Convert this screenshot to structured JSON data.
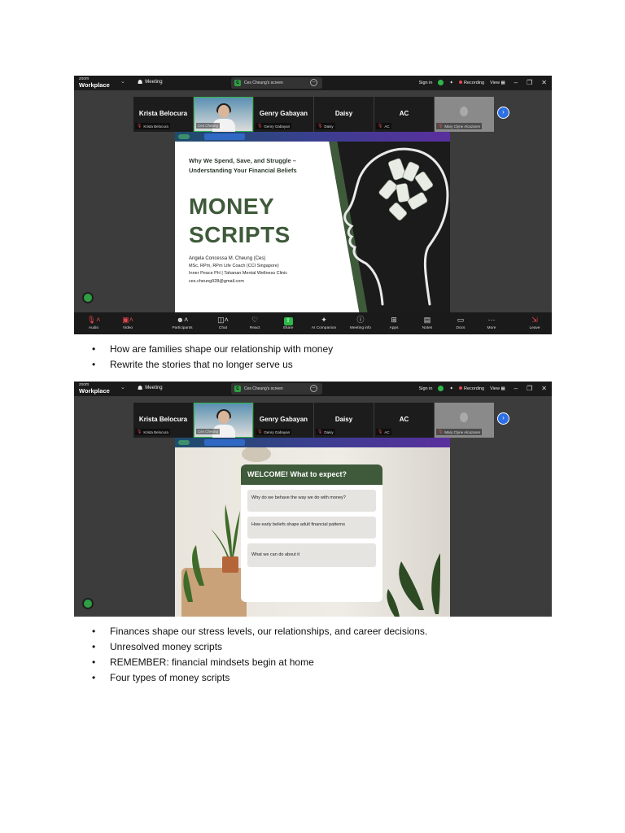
{
  "zoom": {
    "brand_small": "zoom",
    "brand_big": "Workplace",
    "meeting_label": "Meeting",
    "screen_pill_letter": "C",
    "screen_pill_text": "Ces Cheung's screen",
    "sign_in": "Sign in",
    "recording": "Recording",
    "view": "View",
    "participants": [
      {
        "big": "Krista Belocura",
        "small": "Krista Belocura"
      },
      {
        "big": "",
        "small": "Ces Cheung"
      },
      {
        "big": "Genry Gabayan",
        "small": "Genry Gabayan"
      },
      {
        "big": "Daisy",
        "small": "Daisy"
      },
      {
        "big": "AC",
        "small": "AC"
      },
      {
        "big": "",
        "small": "Mary Clyne Alcazaren"
      }
    ],
    "toolbar": [
      {
        "label": "Audio",
        "icon": "mic-icon"
      },
      {
        "label": "Video",
        "icon": "video-off-icon"
      },
      {
        "label": "Participants",
        "icon": "participants-icon",
        "count": "20"
      },
      {
        "label": "Chat",
        "icon": "chat-icon"
      },
      {
        "label": "React",
        "icon": "heart-icon"
      },
      {
        "label": "Share",
        "icon": "share-icon"
      },
      {
        "label": "AI Companion",
        "icon": "sparkle-icon"
      },
      {
        "label": "Meeting info",
        "icon": "info-icon"
      },
      {
        "label": "Apps",
        "icon": "apps-icon"
      },
      {
        "label": "Notes",
        "icon": "notes-icon"
      },
      {
        "label": "Docs",
        "icon": "docs-icon"
      },
      {
        "label": "More",
        "icon": "more-icon"
      },
      {
        "label": "Leave",
        "icon": "leave-icon"
      }
    ]
  },
  "slide1": {
    "subtitle": "Why We Spend, Save, and Struggle – Understanding Your Financial Beliefs",
    "title_line1": "MONEY",
    "title_line2": "SCRIPTS",
    "author_name": "Angela Concessa M. Cheung (Ces)",
    "author_line2": "MSc, RPm, RPm Life Coach (CCI Singapore)",
    "author_line3": "Inner Peace PH | Tahanan Mental Wellness Clinic",
    "author_email": "ces.cheung928@gmail.com"
  },
  "slide2": {
    "card_title": "WELCOME! What to expect?",
    "items": [
      "Why do we behave the way we do with money?",
      "How early beliefs shape adult financial patterns",
      "What we can do about it"
    ]
  },
  "bullets1": [
    "How are families shape our relationship with money",
    "Rewrite the stories that no longer serve us"
  ],
  "bullets2": [
    "Finances shape our stress levels, our relationships, and career decisions.",
    "Unresolved money scripts",
    "REMEMBER: financial mindsets begin at home",
    "Four types of money scripts"
  ],
  "colors": {
    "slide_green": "#3e5a3a",
    "zoom_bg": "#3c3c3c",
    "zoom_bar": "#1a1a1a",
    "share_green": "#2fb84a",
    "accent_blue": "#2d6fe5"
  }
}
